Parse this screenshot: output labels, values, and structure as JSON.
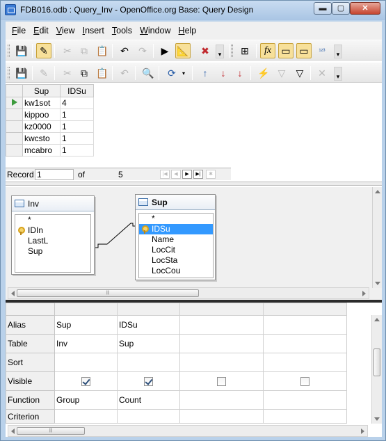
{
  "window": {
    "title": "FDB016.odb : Query_Inv - OpenOffice.org Base: Query Design",
    "min_glyph": "▬",
    "max_glyph": "▢",
    "close_glyph": "✕"
  },
  "menu": [
    {
      "key": "F",
      "rest": "ile"
    },
    {
      "key": "E",
      "rest": "dit"
    },
    {
      "key": "V",
      "rest": "iew"
    },
    {
      "key": "I",
      "rest": "nsert"
    },
    {
      "key": "T",
      "rest": "ools"
    },
    {
      "key": "W",
      "rest": "indow"
    },
    {
      "key": "H",
      "rest": "elp"
    }
  ],
  "icons": {
    "save": "💾",
    "edit": "✎",
    "cut": "✂",
    "copy": "⧉",
    "paste": "📋",
    "undo": "↶",
    "redo": "↷",
    "run": "▶",
    "design": "📐",
    "clear": "✖",
    "add_table": "⊞",
    "functions": "fx",
    "table_names": "▭",
    "alias": "▭",
    "distinct": "¹²³",
    "find": "🔍",
    "refresh": "⟳",
    "sort_asc": "↑",
    "sort_desc": "↓",
    "autofilter": "⚡",
    "filter": "▽",
    "standard_filter": "▽",
    "remove_filter": "✕",
    "overflow": "▾"
  },
  "results": {
    "columns": [
      "Sup",
      "IDSu"
    ],
    "rows": [
      {
        "sup": "kw1sot",
        "idsu": "4"
      },
      {
        "sup": "kippoo",
        "idsu": "1"
      },
      {
        "sup": "kz0000",
        "idsu": "1"
      },
      {
        "sup": "kwcsto",
        "idsu": "1"
      },
      {
        "sup": "mcabro",
        "idsu": "1"
      }
    ]
  },
  "navigation": {
    "record_label": "Record",
    "record_value": "1",
    "of_label": "of",
    "total": "5"
  },
  "tables": {
    "inv": {
      "name": "Inv",
      "fields": [
        "*",
        "IDIn",
        "LastL",
        "Sup"
      ]
    },
    "sup": {
      "name": "Sup",
      "fields": [
        "*",
        "IDSu",
        "Name",
        "LocCit",
        "LocSta",
        "LocCou"
      ]
    }
  },
  "criteria": {
    "labels": {
      "alias": "Alias",
      "table": "Table",
      "sort": "Sort",
      "visible": "Visible",
      "function": "Function",
      "criterion": "Criterion"
    },
    "columns": [
      {
        "alias": "Sup",
        "table": "Inv",
        "sort": "",
        "visible": true,
        "function": "Group"
      },
      {
        "alias": "IDSu",
        "table": "Sup",
        "sort": "",
        "visible": true,
        "function": "Count"
      },
      {
        "alias": "",
        "table": "",
        "sort": "",
        "visible": false,
        "function": ""
      },
      {
        "alias": "",
        "table": "",
        "sort": "",
        "visible": false,
        "function": ""
      }
    ]
  },
  "colors": {
    "selection": "#3399ff",
    "title_bar": "#b9d1ea",
    "close_button": "#c6452f"
  }
}
